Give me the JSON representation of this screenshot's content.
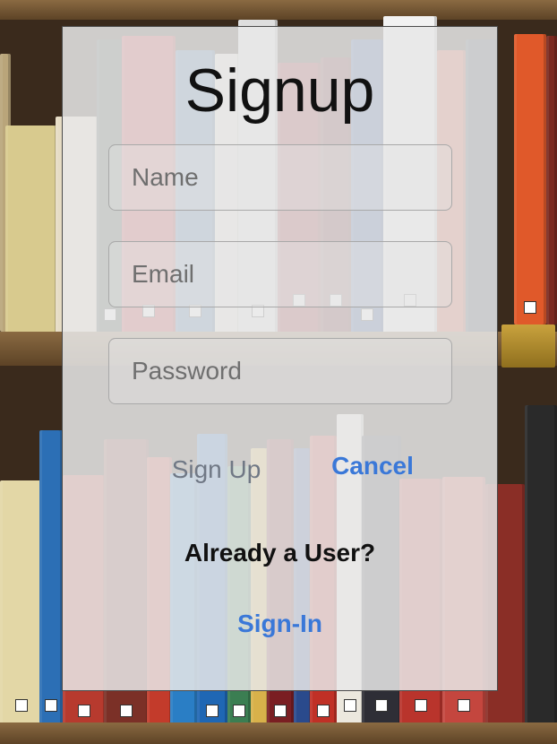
{
  "signup": {
    "title": "Signup",
    "fields": {
      "name_placeholder": "Name",
      "name_value": "",
      "email_placeholder": "Email",
      "email_value": "",
      "password_placeholder": "Password",
      "password_value": ""
    },
    "signup_label": "Sign Up",
    "cancel_label": "Cancel",
    "already_user_text": "Already a User?",
    "signin_label": "Sign-In"
  },
  "colors": {
    "accent": "#3a78d8",
    "card_bg": "#e8e8e8",
    "title_text": "#111111",
    "muted_button": "#707885"
  }
}
